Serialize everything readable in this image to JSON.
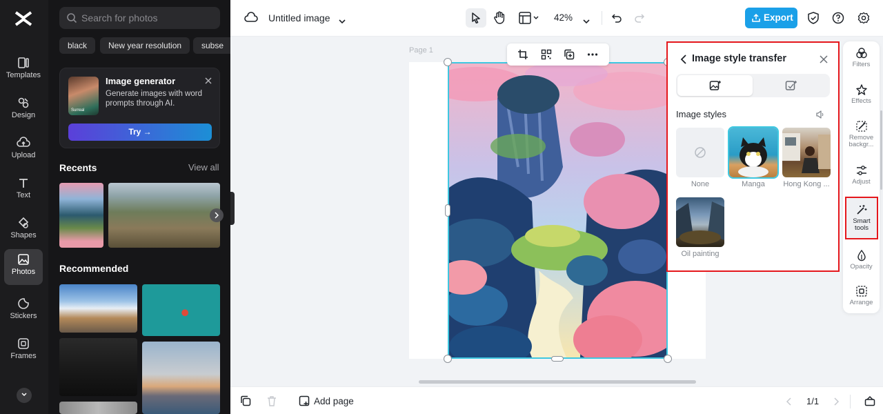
{
  "nav": {
    "items": [
      {
        "label": "Templates",
        "icon": "templates-icon"
      },
      {
        "label": "Design",
        "icon": "design-icon"
      },
      {
        "label": "Upload",
        "icon": "upload-cloud-icon"
      },
      {
        "label": "Text",
        "icon": "text-icon"
      },
      {
        "label": "Shapes",
        "icon": "shapes-icon"
      },
      {
        "label": "Photos",
        "icon": "photos-icon",
        "active": true
      },
      {
        "label": "Stickers",
        "icon": "stickers-icon"
      },
      {
        "label": "Frames",
        "icon": "frames-icon"
      }
    ]
  },
  "panel": {
    "search_placeholder": "Search for photos",
    "chips": [
      "black",
      "New year resolution",
      "subse"
    ],
    "generator": {
      "title": "Image generator",
      "description": "Generate images with word prompts through AI.",
      "try_label": "Try →",
      "thumb_caption": "Surreal"
    },
    "recents_title": "Recents",
    "view_all": "View all",
    "recommended_title": "Recommended"
  },
  "topbar": {
    "doc_title": "Untitled image",
    "zoom": "42%",
    "export_label": "Export"
  },
  "canvas": {
    "page_label": "Page 1"
  },
  "style_panel": {
    "title": "Image style transfer",
    "section_label": "Image styles",
    "styles": [
      {
        "name": "None"
      },
      {
        "name": "Manga",
        "selected": true
      },
      {
        "name": "Hong Kong ..."
      },
      {
        "name": "Oil painting"
      }
    ]
  },
  "right_tools": [
    {
      "label": "Filters",
      "icon": "filters-icon"
    },
    {
      "label": "Effects",
      "icon": "effects-icon"
    },
    {
      "label": "Remove backgr...",
      "icon": "remove-background-icon"
    },
    {
      "label": "Adjust",
      "icon": "adjust-icon"
    },
    {
      "label": "Smart tools",
      "icon": "smart-tools-icon",
      "highlighted": true
    },
    {
      "label": "Opacity",
      "icon": "opacity-icon"
    },
    {
      "label": "Arrange",
      "icon": "arrange-icon"
    }
  ],
  "bottombar": {
    "add_page_label": "Add page",
    "page_indicator": "1/1"
  },
  "colors": {
    "accent": "#1aa0e8",
    "highlight_border": "#e5161b",
    "selection": "#3ec7e0"
  }
}
